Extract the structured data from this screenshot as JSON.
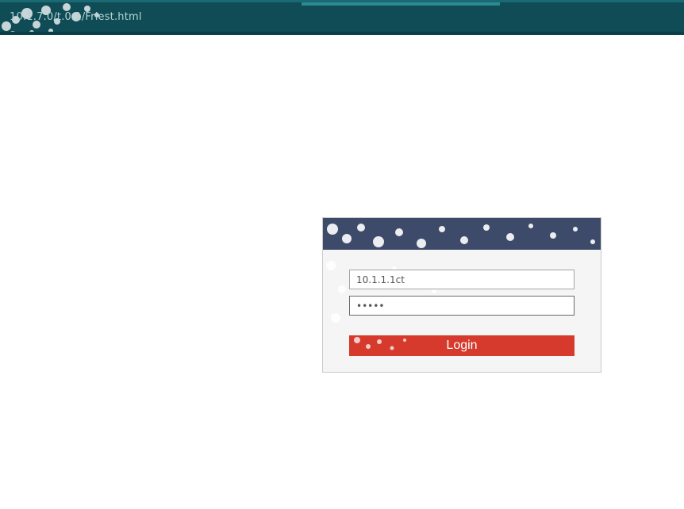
{
  "browser": {
    "url": "10.1.7.0/t.0.1/Friest.html"
  },
  "login_form": {
    "username_value": "10.1.1.1ct",
    "password_value": "•••••",
    "login_label": "Login"
  },
  "colors": {
    "topbar": "#0f4c55",
    "panel_header": "#3d4a6a",
    "panel_background": "#f5f5f5",
    "login_button": "#d63a2c"
  }
}
